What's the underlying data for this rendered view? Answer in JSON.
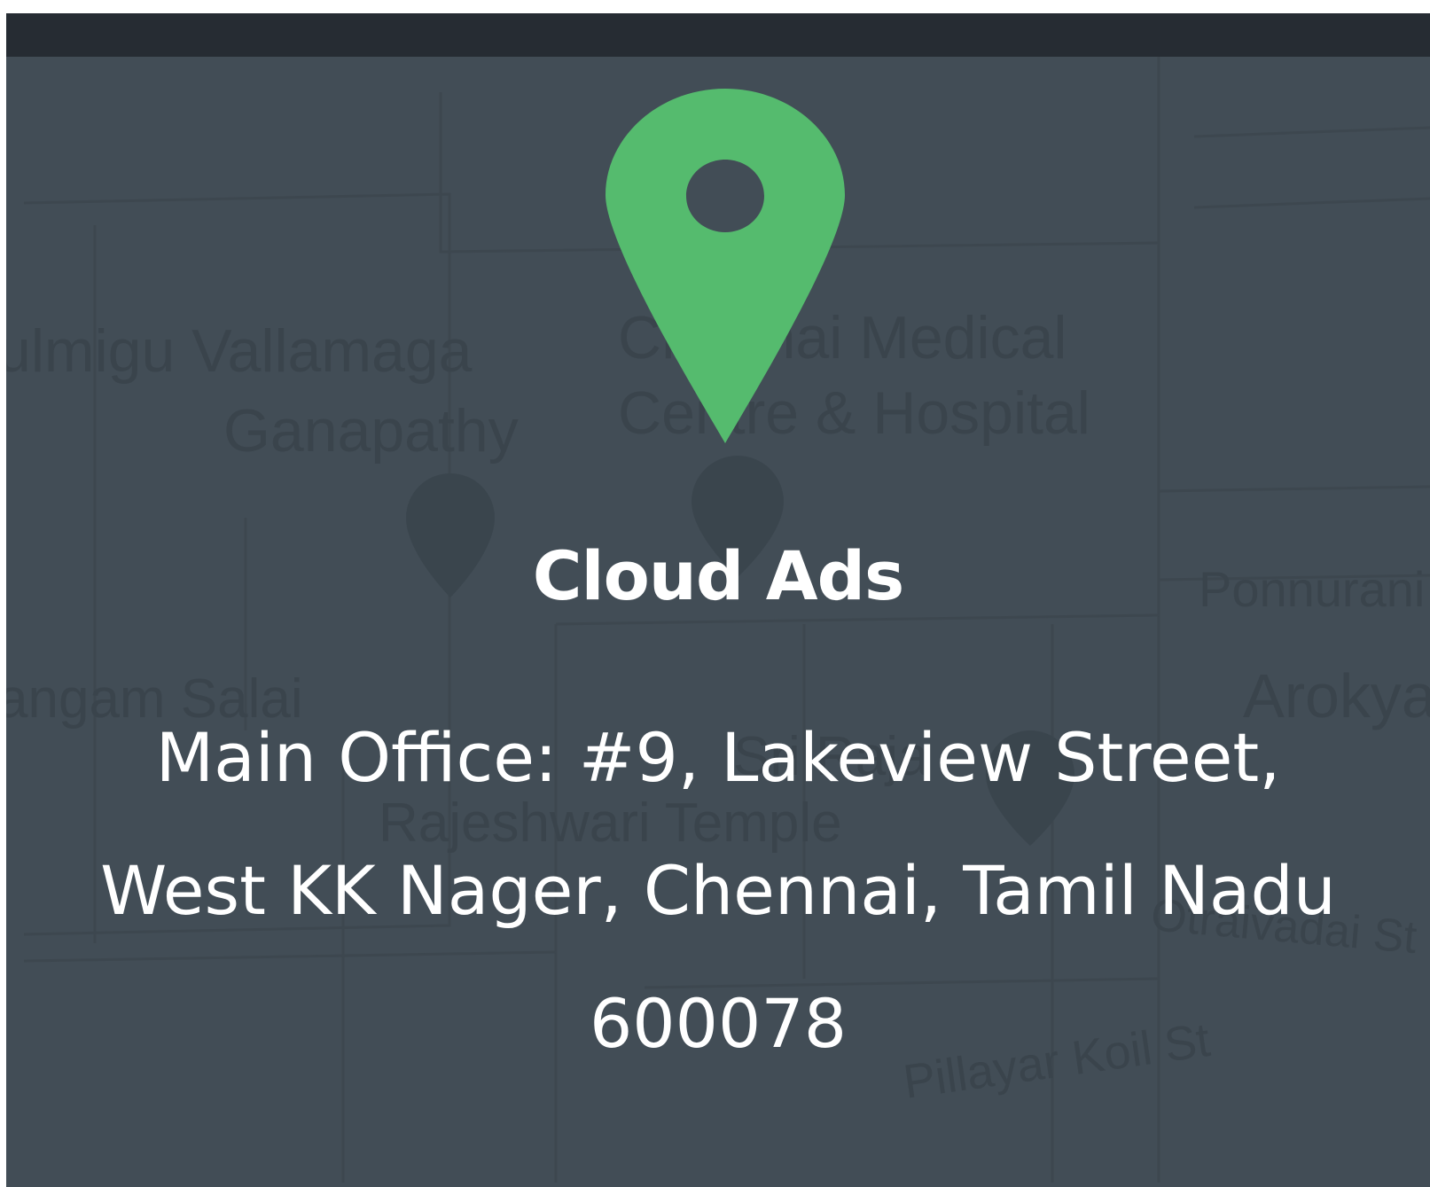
{
  "map": {
    "labels": {
      "temple_1": "ulmigu Vallamaga",
      "temple_1b": "Ganapathy",
      "hospital_1": "Chennai Medical",
      "hospital_1b": "Centre & Hospital",
      "street_1": "Ponnurani",
      "place_1": "Arokya",
      "street_2": "angam Salai",
      "temple_2": "Sri Raja",
      "temple_2b": "Rajeshwari Temple",
      "street_3": "Otraivadai St",
      "street_4": "Pillayar Koil St"
    }
  },
  "location": {
    "pin_icon": "map-pin-icon",
    "company_name": "Cloud Ads",
    "address": "Main Office: #9, Lakeview Street, West KK Nager, Chennai, Tamil Nadu 600078"
  },
  "colors": {
    "overlay": "#424d56",
    "topbar": "#262c33",
    "pin": "#55bb6e",
    "text": "#ffffff"
  }
}
